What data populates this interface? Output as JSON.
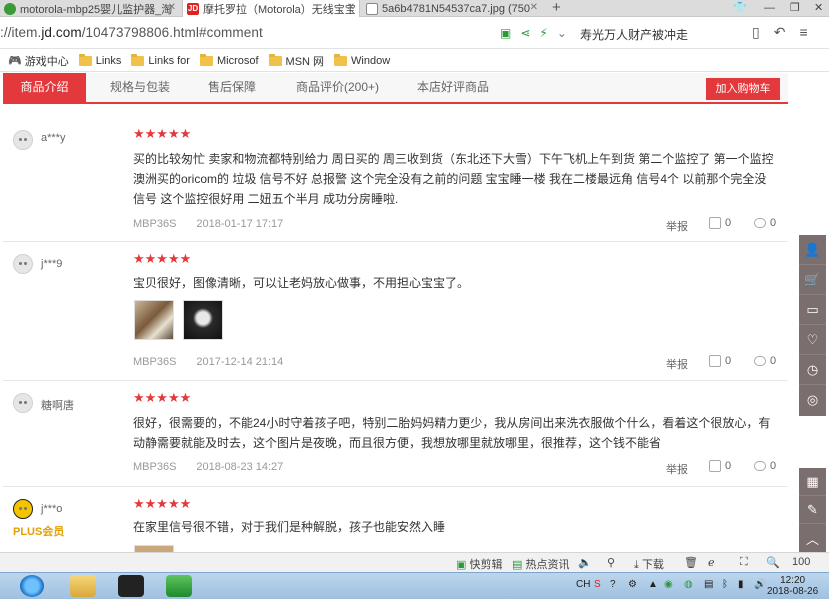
{
  "browser": {
    "tabs": [
      {
        "title": "motorola-mbp25婴儿监护器_淘",
        "favicon_color": "#3a9a3a",
        "active": false
      },
      {
        "title": "摩托罗拉（Motorola）无线宝宝",
        "favicon_color": "#d22",
        "favicon_text": "JD",
        "active": true
      },
      {
        "title": "5a6b4781N54537ca7.jpg (750",
        "favicon_color": "#888",
        "active": false
      }
    ],
    "new_tab": "+",
    "url_prefix": "://item.",
    "url_domain": "jd.com",
    "url_path": "/10473798806.html#comment",
    "search_text": "寿光万人财产被冲走",
    "bookmarks": [
      "游戏中心",
      "Links",
      "Links for",
      "Microsof",
      "MSN 网",
      "Window"
    ]
  },
  "jd_tabs": {
    "items": [
      "商品介绍",
      "规格与包装",
      "售后保障",
      "商品评价(200+)",
      "本店好评商品"
    ],
    "cart_button": "加入购物车"
  },
  "reviews": [
    {
      "user": "a***y",
      "stars": "★★★★★",
      "content": "买的比较匆忙 卖家和物流都特别给力 周日买的 周三收到货（东北还下大雪）下午飞机上午到货 第二个监控了 第一个监控澳洲买的oricom的 垃圾 信号不好 总报警 这个完全没有之前的问题 宝宝睡一楼 我在二楼最远角 信号4个 以前那个完全没信号 这个监控很好用 二妞五个半月 成功分房睡啦.",
      "model": "MBP36S",
      "date": "2018-01-17 17:17",
      "report": "举报",
      "likes": "0",
      "comments": "0"
    },
    {
      "user": "j***9",
      "stars": "★★★★★",
      "content": "宝贝很好，图像清晰，可以让老妈放心做事，不用担心宝宝了。",
      "model": "MBP36S",
      "date": "2017-12-14 21:14",
      "report": "举报",
      "likes": "0",
      "comments": "0"
    },
    {
      "user": "糖啊唐",
      "stars": "★★★★★",
      "content": "很好，很需要的，不能24小时守着孩子吧，特别二胎妈妈精力更少，我从房间出来洗衣服做个什么，看着这个很放心，有动静需要就能及时去，这个图片是夜晚，而且很方便，我想放哪里就放哪里，很推荐，这个钱不能省",
      "model": "MBP36S",
      "date": "2018-08-23 14:27",
      "report": "举报",
      "likes": "0",
      "comments": "0"
    },
    {
      "user": "j***o",
      "badge": "PLUS会员",
      "stars": "★★★★★",
      "content": "在家里信号很不错，对于我们是种解脱，孩子也能安然入睡"
    }
  ],
  "statusbar": {
    "quick_cut": "快剪辑",
    "hot_news": "热点资讯",
    "download": "下载",
    "zoom": "100"
  },
  "taskbar": {
    "lang": "CH",
    "time": "12:20",
    "date": "2018-08-26"
  }
}
